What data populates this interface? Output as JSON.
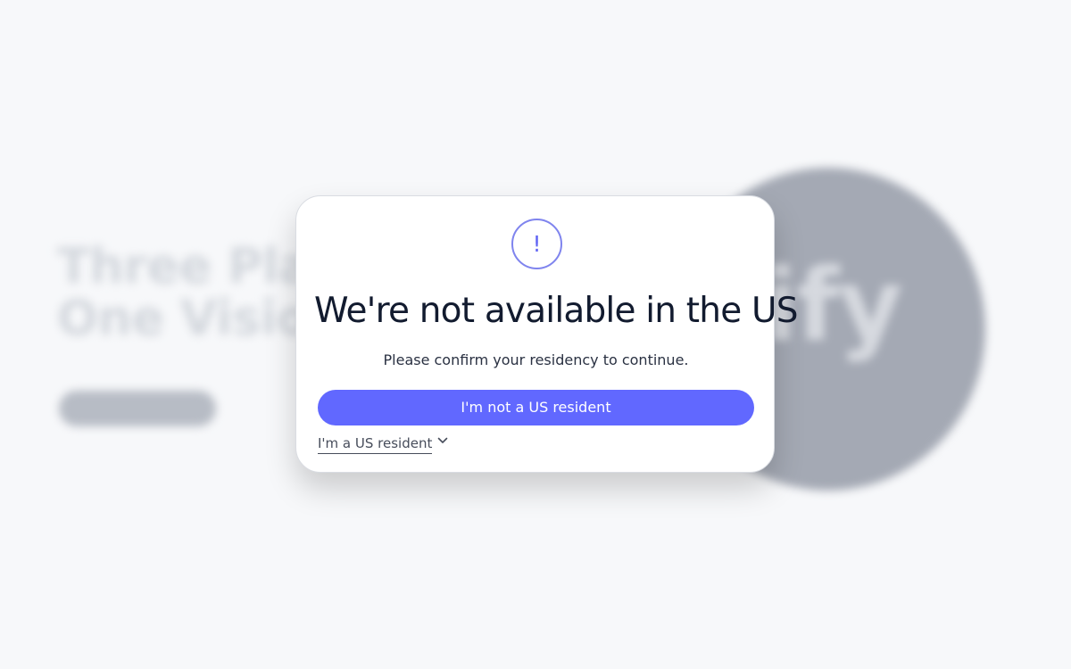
{
  "background": {
    "hero_title_line_1": "Three Plat",
    "hero_title_line_2": "One Visio",
    "hero_subtitle": "",
    "hero_cta_label": "",
    "logo_text": "tify"
  },
  "modal": {
    "icon": "exclamation-icon",
    "icon_text": "!",
    "title": "We're not available in the US",
    "message": "Please confirm your residency to continue.",
    "primary_button_label": "I'm not a US resident",
    "secondary_toggle_label": "I'm a US resident",
    "secondary_icon": "chevron-down-icon"
  },
  "colors": {
    "page_background": "#f7f8fa",
    "modal_background": "#ffffff",
    "accent": "#6168ff",
    "title_text": "#121b2f",
    "body_text": "#2a3142",
    "muted_link_text": "#474d5b",
    "background_circle": "#a4a9b4"
  }
}
